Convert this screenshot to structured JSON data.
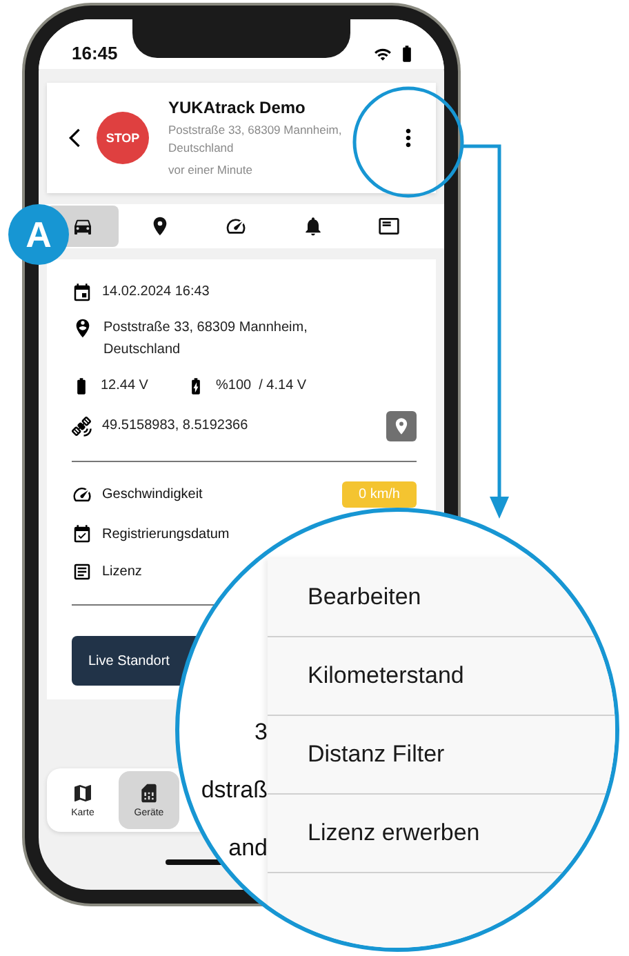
{
  "status_bar": {
    "time": "16:45"
  },
  "header": {
    "badge": "STOP",
    "title": "YUKAtrack Demo",
    "address": "Poststraße 33, 68309 Mannheim, Deutschland",
    "updated": "vor einer Minute"
  },
  "tabs": [
    {
      "kind": "car",
      "selected": true
    },
    {
      "kind": "location",
      "selected": false
    },
    {
      "kind": "speed",
      "selected": false
    },
    {
      "kind": "alarm",
      "selected": false
    },
    {
      "kind": "report",
      "selected": false
    }
  ],
  "info": {
    "datetime": "14.02.2024 16:43",
    "address": "Poststraße 33, 68309 Mannheim, Deutschland",
    "battery_voltage": "12.44 V",
    "device_battery": "%100  / 4.14 V",
    "coordinates": "49.5158983, 8.5192366"
  },
  "details": [
    {
      "kind": "speed",
      "label": "Geschwindigkeit",
      "value": "0 km/h"
    },
    {
      "kind": "registration",
      "label": "Registrierungsdatum"
    },
    {
      "kind": "license",
      "label": "Lizenz"
    }
  ],
  "live_button": "Live Standort",
  "bottom_nav": [
    {
      "kind": "map",
      "label": "Karte",
      "selected": false
    },
    {
      "kind": "device",
      "label": "Geräte",
      "selected": true
    }
  ],
  "magnifier": {
    "fragments": [
      "3",
      "dstraß",
      "and"
    ],
    "menu": [
      "Bearbeiten",
      "Kilometerstand",
      "Distanz Filter",
      "Lizenz erwerben"
    ]
  },
  "callout": {
    "label": "A"
  }
}
